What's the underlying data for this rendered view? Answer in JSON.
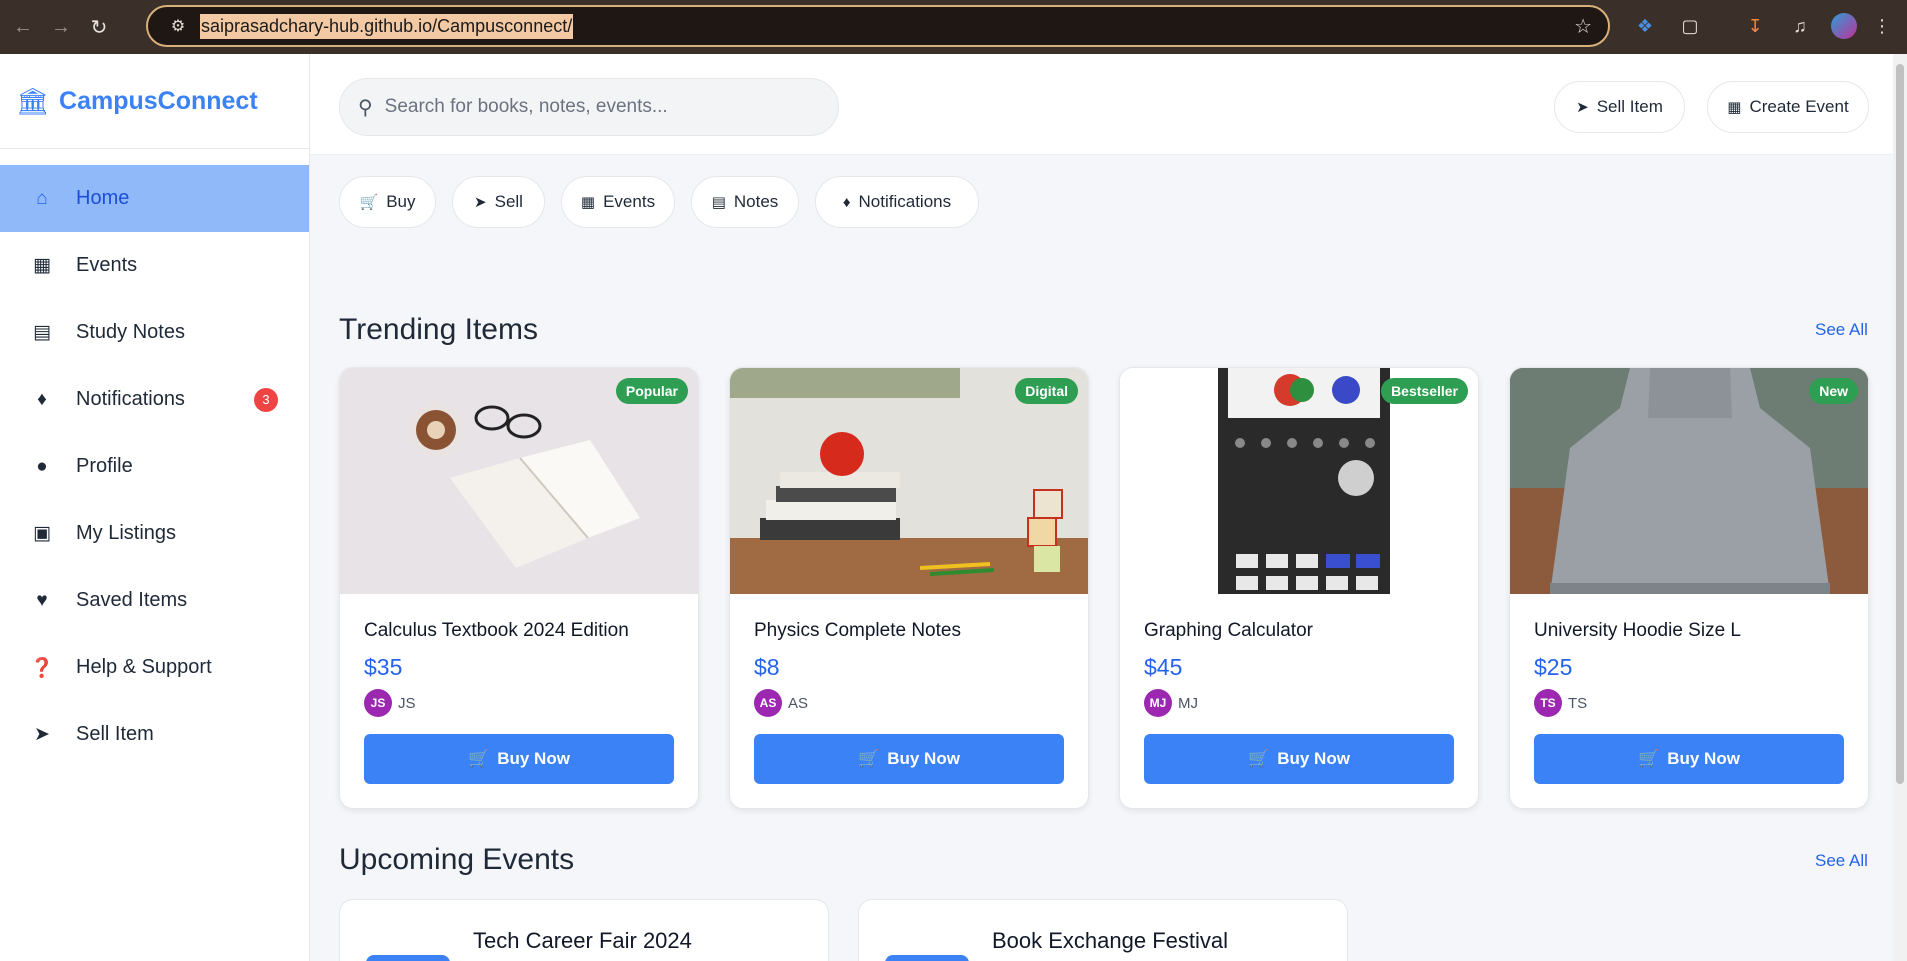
{
  "browser": {
    "url": "saiprasadchary-hub.github.io/Campusconnect/"
  },
  "brand": {
    "name": "CampusConnect",
    "icon": "university-icon"
  },
  "sidebar": {
    "items": [
      {
        "label": "Home",
        "icon": "home-icon",
        "active": true
      },
      {
        "label": "Events",
        "icon": "calendar-icon"
      },
      {
        "label": "Study Notes",
        "icon": "document-icon"
      },
      {
        "label": "Notifications",
        "icon": "bell-icon",
        "badge": "3"
      },
      {
        "label": "Profile",
        "icon": "user-icon"
      },
      {
        "label": "My Listings",
        "icon": "shopping-bag-icon"
      },
      {
        "label": "Saved Items",
        "icon": "heart-icon"
      },
      {
        "label": "Help & Support",
        "icon": "question-icon"
      },
      {
        "label": "Sell Item",
        "icon": "tag-icon"
      }
    ]
  },
  "header": {
    "search_placeholder": "Search for books, notes, events...",
    "sell_label": "Sell Item",
    "create_event_label": "Create Event"
  },
  "quick_filters": [
    {
      "label": "Buy",
      "icon": "cart-icon"
    },
    {
      "label": "Sell",
      "icon": "tag-icon"
    },
    {
      "label": "Events",
      "icon": "calendar-icon"
    },
    {
      "label": "Notes",
      "icon": "document-icon"
    },
    {
      "label": "Notifications",
      "icon": "bell-icon"
    }
  ],
  "trending": {
    "title": "Trending Items",
    "see_all": "See All",
    "items": [
      {
        "title": "Calculus Textbook 2024 Edition",
        "price": "$35",
        "tag": "Popular",
        "seller_initials": "JS",
        "seller_name": "JS",
        "buy_label": "Buy Now"
      },
      {
        "title": "Physics Complete Notes",
        "price": "$8",
        "tag": "Digital",
        "seller_initials": "AS",
        "seller_name": "AS",
        "buy_label": "Buy Now"
      },
      {
        "title": "Graphing Calculator",
        "price": "$45",
        "tag": "Bestseller",
        "seller_initials": "MJ",
        "seller_name": "MJ",
        "buy_label": "Buy Now"
      },
      {
        "title": "University Hoodie Size L",
        "price": "$25",
        "tag": "New",
        "seller_initials": "TS",
        "seller_name": "TS",
        "buy_label": "Buy Now"
      }
    ]
  },
  "events": {
    "title": "Upcoming Events",
    "see_all": "See All",
    "items": [
      {
        "title": "Tech Career Fair 2024"
      },
      {
        "title": "Book Exchange Festival"
      }
    ]
  },
  "colors": {
    "primary": "#3b82f6",
    "active_bg": "#8fb9f8",
    "tag_green": "#2e9e52",
    "avatar_purple": "#9c27b0",
    "badge_red": "#ef4444"
  }
}
